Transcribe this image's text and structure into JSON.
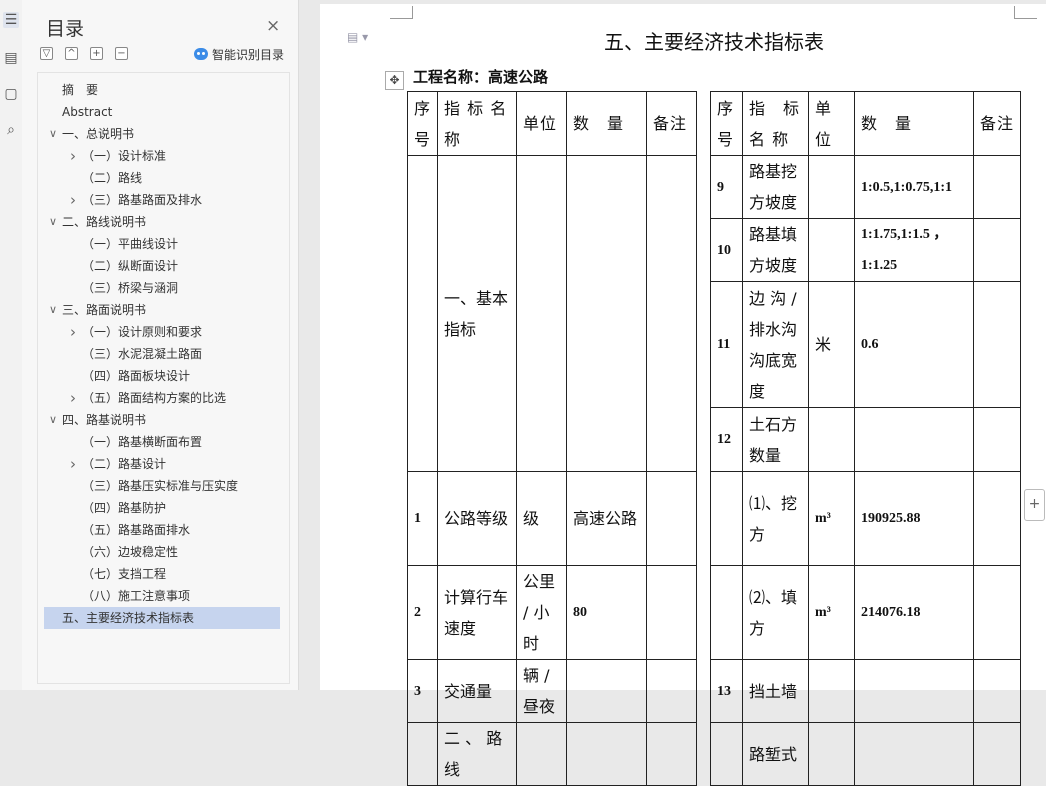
{
  "rail": {
    "icons": [
      "menu-icon",
      "outline-icon",
      "bookmark-icon",
      "find-icon"
    ]
  },
  "toc": {
    "title": "目录",
    "close": "×",
    "tools": [
      "▽",
      "^",
      "+",
      "−"
    ],
    "smart_label": "智能识别目录",
    "items": [
      {
        "label": "摘　要",
        "level": 1,
        "chev": ""
      },
      {
        "label": "Abstract",
        "level": 1,
        "chev": ""
      },
      {
        "label": "一、总说明书",
        "level": 1,
        "chev": "down"
      },
      {
        "label": "（一）设计标准",
        "level": 2,
        "chev": "right"
      },
      {
        "label": "（二）路线",
        "level": 2,
        "chev": ""
      },
      {
        "label": "（三）路基路面及排水",
        "level": 2,
        "chev": "right"
      },
      {
        "label": "二、路线说明书",
        "level": 1,
        "chev": "down"
      },
      {
        "label": "（一）平曲线设计",
        "level": 2,
        "chev": ""
      },
      {
        "label": "（二）纵断面设计",
        "level": 2,
        "chev": ""
      },
      {
        "label": "（三）桥梁与涵洞",
        "level": 2,
        "chev": ""
      },
      {
        "label": "三、路面说明书",
        "level": 1,
        "chev": "down"
      },
      {
        "label": "（一）设计原则和要求",
        "level": 2,
        "chev": "right"
      },
      {
        "label": "（三）水泥混凝土路面",
        "level": 2,
        "chev": ""
      },
      {
        "label": "（四）路面板块设计",
        "level": 2,
        "chev": ""
      },
      {
        "label": "（五）路面结构方案的比选",
        "level": 2,
        "chev": "right"
      },
      {
        "label": "四、路基说明书",
        "level": 1,
        "chev": "down"
      },
      {
        "label": "（一）路基横断面布置",
        "level": 2,
        "chev": ""
      },
      {
        "label": "（二）路基设计",
        "level": 2,
        "chev": "right"
      },
      {
        "label": "（三）路基压实标准与压实度",
        "level": 2,
        "chev": ""
      },
      {
        "label": "（四）路基防护",
        "level": 2,
        "chev": ""
      },
      {
        "label": "（五）路基路面排水",
        "level": 2,
        "chev": ""
      },
      {
        "label": "（六）边坡稳定性",
        "level": 2,
        "chev": ""
      },
      {
        "label": "（七）支挡工程",
        "level": 2,
        "chev": ""
      },
      {
        "label": "（八）施工注意事项",
        "level": 2,
        "chev": ""
      },
      {
        "label": "五、主要经济技术指标表",
        "level": 1,
        "chev": "",
        "selected": true
      }
    ]
  },
  "document": {
    "title": "五、主要经济技术指标表",
    "project": "工程名称：高速公路",
    "table": {
      "headers_left": [
        "序号",
        "指 标 名 称",
        "单位",
        "数　量",
        "备注"
      ],
      "headers_right": [
        "序号",
        "指　标 名 称",
        "单位",
        "数　量",
        "备注"
      ],
      "left_rows": [
        {
          "no": "",
          "name": "一、基本指标",
          "unit": "",
          "qty": "",
          "note": ""
        },
        {
          "no": "1",
          "name": "公路等级",
          "unit": "级",
          "qty": "高速公路",
          "note": ""
        },
        {
          "no": "2",
          "name": "计算行车速度",
          "unit": "公里 / 小时",
          "qty": "80",
          "note": ""
        },
        {
          "no": "3",
          "name": "交通量",
          "unit": "辆 / 昼夜",
          "qty": "",
          "note": ""
        },
        {
          "no": "",
          "name": "二 、 路线",
          "unit": "",
          "qty": "",
          "note": ""
        }
      ],
      "right_rows": [
        {
          "no": "9",
          "name": "路基挖方坡度",
          "unit": "",
          "qty": "1:0.5,1:0.75,1:1",
          "note": ""
        },
        {
          "no": "10",
          "name": "路基填方坡度",
          "unit": "",
          "qty": "1:1.75,1:1.5 ，1:1.25",
          "note": ""
        },
        {
          "no": "11",
          "name": "边 沟 / 排水沟沟底宽度",
          "unit": "米",
          "qty": "0.6",
          "note": ""
        },
        {
          "no": "12",
          "name": "土石方数量",
          "unit": "",
          "qty": "",
          "note": ""
        },
        {
          "no": "",
          "name": "⑴、挖方",
          "unit": "m³",
          "qty": "190925.88",
          "note": ""
        },
        {
          "no": "",
          "name": "⑵、填方",
          "unit": "m³",
          "qty": "214076.18",
          "note": ""
        },
        {
          "no": "13",
          "name": "挡土墙",
          "unit": "",
          "qty": "",
          "note": ""
        },
        {
          "no": "",
          "name": "路堑式",
          "unit": "",
          "qty": "",
          "note": ""
        }
      ]
    }
  }
}
